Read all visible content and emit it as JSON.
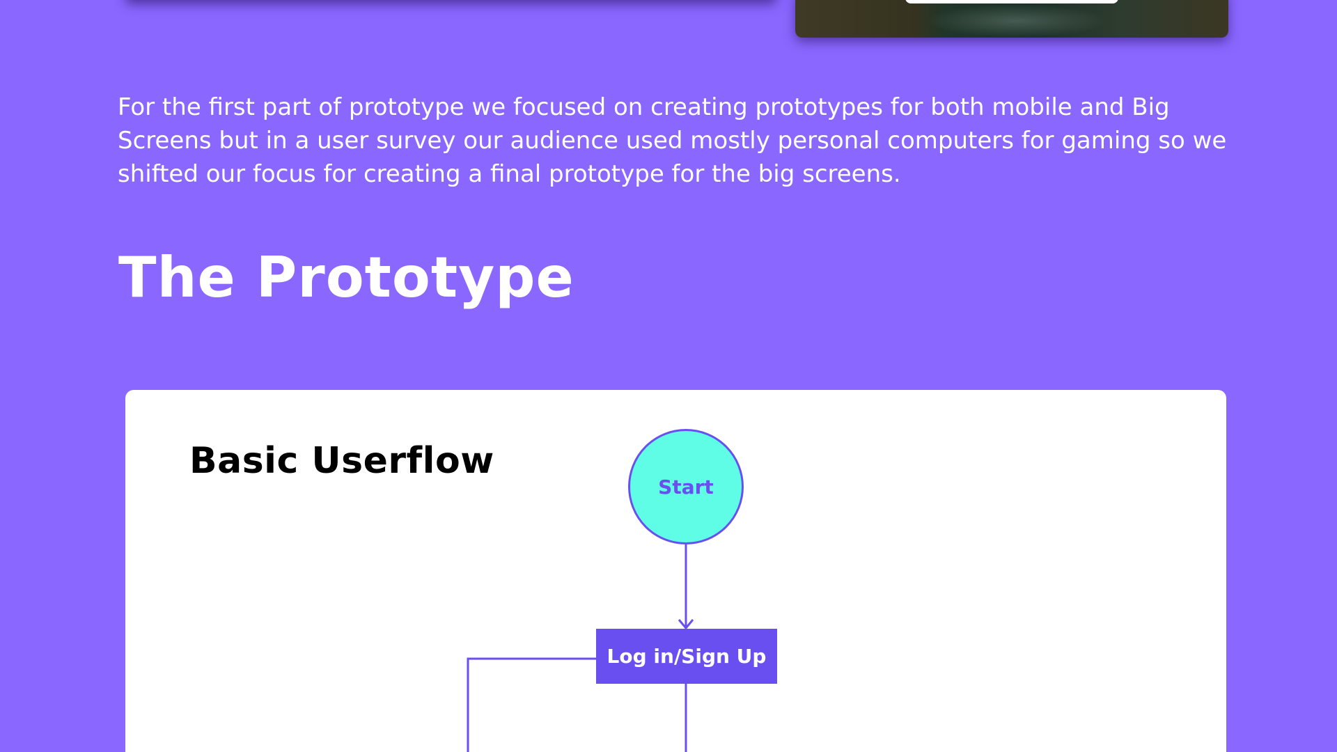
{
  "intro": {
    "text": "For the first part of prototype we focused on creating prototypes for both mobile and Big Screens but in a user survey our audience used mostly personal computers for gaming so we shifted our focus for creating a final prototype for the big screens."
  },
  "section": {
    "heading": "The Prototype"
  },
  "diagram": {
    "title": "Basic Userflow",
    "nodes": {
      "start": "Start",
      "login": "Log in/Sign Up"
    }
  },
  "colors": {
    "background": "#8a67ff",
    "accent": "#6a4ff0",
    "start_node_fill": "#5ffde6",
    "card": "#ffffff"
  }
}
